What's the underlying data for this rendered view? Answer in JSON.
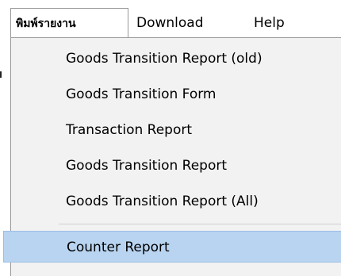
{
  "menubar": {
    "items": [
      {
        "label": "พิมพ์รายงาน",
        "active": true
      },
      {
        "label": "Download"
      },
      {
        "label": "Help"
      }
    ]
  },
  "dropdown": {
    "entries": [
      "Goods Transition Report (old)",
      "Goods Transition Form",
      "Transaction Report",
      "Goods Transition Report",
      "Goods Transition Report (All)",
      "Counter Report"
    ],
    "highlighted_index": 5
  },
  "colors": {
    "menu_background": "#f2f2f2",
    "highlight": "#b8d4f0",
    "border": "#999999"
  }
}
